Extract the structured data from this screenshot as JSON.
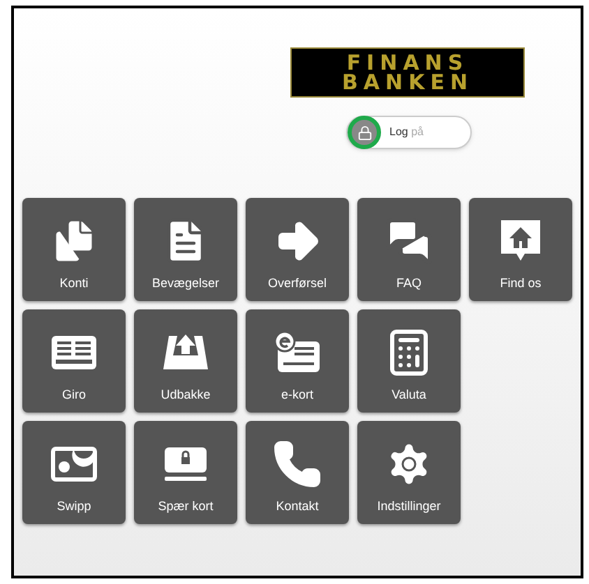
{
  "logo": {
    "line_1": "FINANS",
    "line_2": "BANKEN"
  },
  "login_toggle": {
    "label": "Log",
    "label_suffix": "på"
  },
  "tile_rows": [
    [
      {
        "label": "Konti"
      },
      {
        "label": "Bevægelser"
      },
      {
        "label": "Overførsel"
      },
      {
        "label": "FAQ"
      },
      {
        "label": "Find os"
      }
    ],
    [
      {
        "label": "Giro"
      },
      {
        "label": "Udbakke"
      },
      {
        "label": "e-kort"
      },
      {
        "label": "Valuta"
      }
    ],
    [
      {
        "label": "Swipp"
      },
      {
        "label": "Spær kort"
      },
      {
        "label": "Kontakt"
      },
      {
        "label": "Indstillinger"
      }
    ]
  ]
}
